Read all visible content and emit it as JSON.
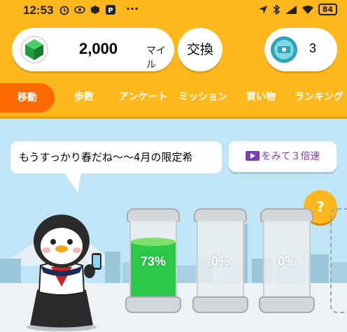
{
  "status_bar": {
    "time": "12:53",
    "more": "···",
    "battery": "84"
  },
  "header": {
    "miles_value": "2,000",
    "miles_unit": "マイル",
    "exchange_label": "交換",
    "ticket_count": "3"
  },
  "tabs": [
    {
      "label": "移動",
      "active": true
    },
    {
      "label": "歩数"
    },
    {
      "label": "アンケート"
    },
    {
      "label": "ミッション"
    },
    {
      "label": "買い物"
    },
    {
      "label": "ランキング"
    }
  ],
  "scene": {
    "bubble_text": "もうすっかり春だね〜〜4月の限定希",
    "video_button_label": "をみて３倍速",
    "help_label": "?",
    "tanks": [
      {
        "percent_label": "73%",
        "fill": 0.73
      },
      {
        "percent_label": "0%",
        "fill": 0
      },
      {
        "percent_label": "0%",
        "fill": 0
      }
    ]
  },
  "colors": {
    "brand": "#ffb81c",
    "active_tab": "#ff6a00",
    "tank_fill": "#2bc84a",
    "video_text": "#7b3fb5",
    "sky": "#bfe5f7"
  },
  "icons": [
    "alarm-icon",
    "eye-icon",
    "box-icon",
    "pay-icon",
    "location-icon",
    "bluetooth-icon",
    "signal-icon",
    "wifi-icon",
    "battery-icon",
    "gem-icon",
    "ticket-icon",
    "video-icon",
    "help-icon"
  ]
}
